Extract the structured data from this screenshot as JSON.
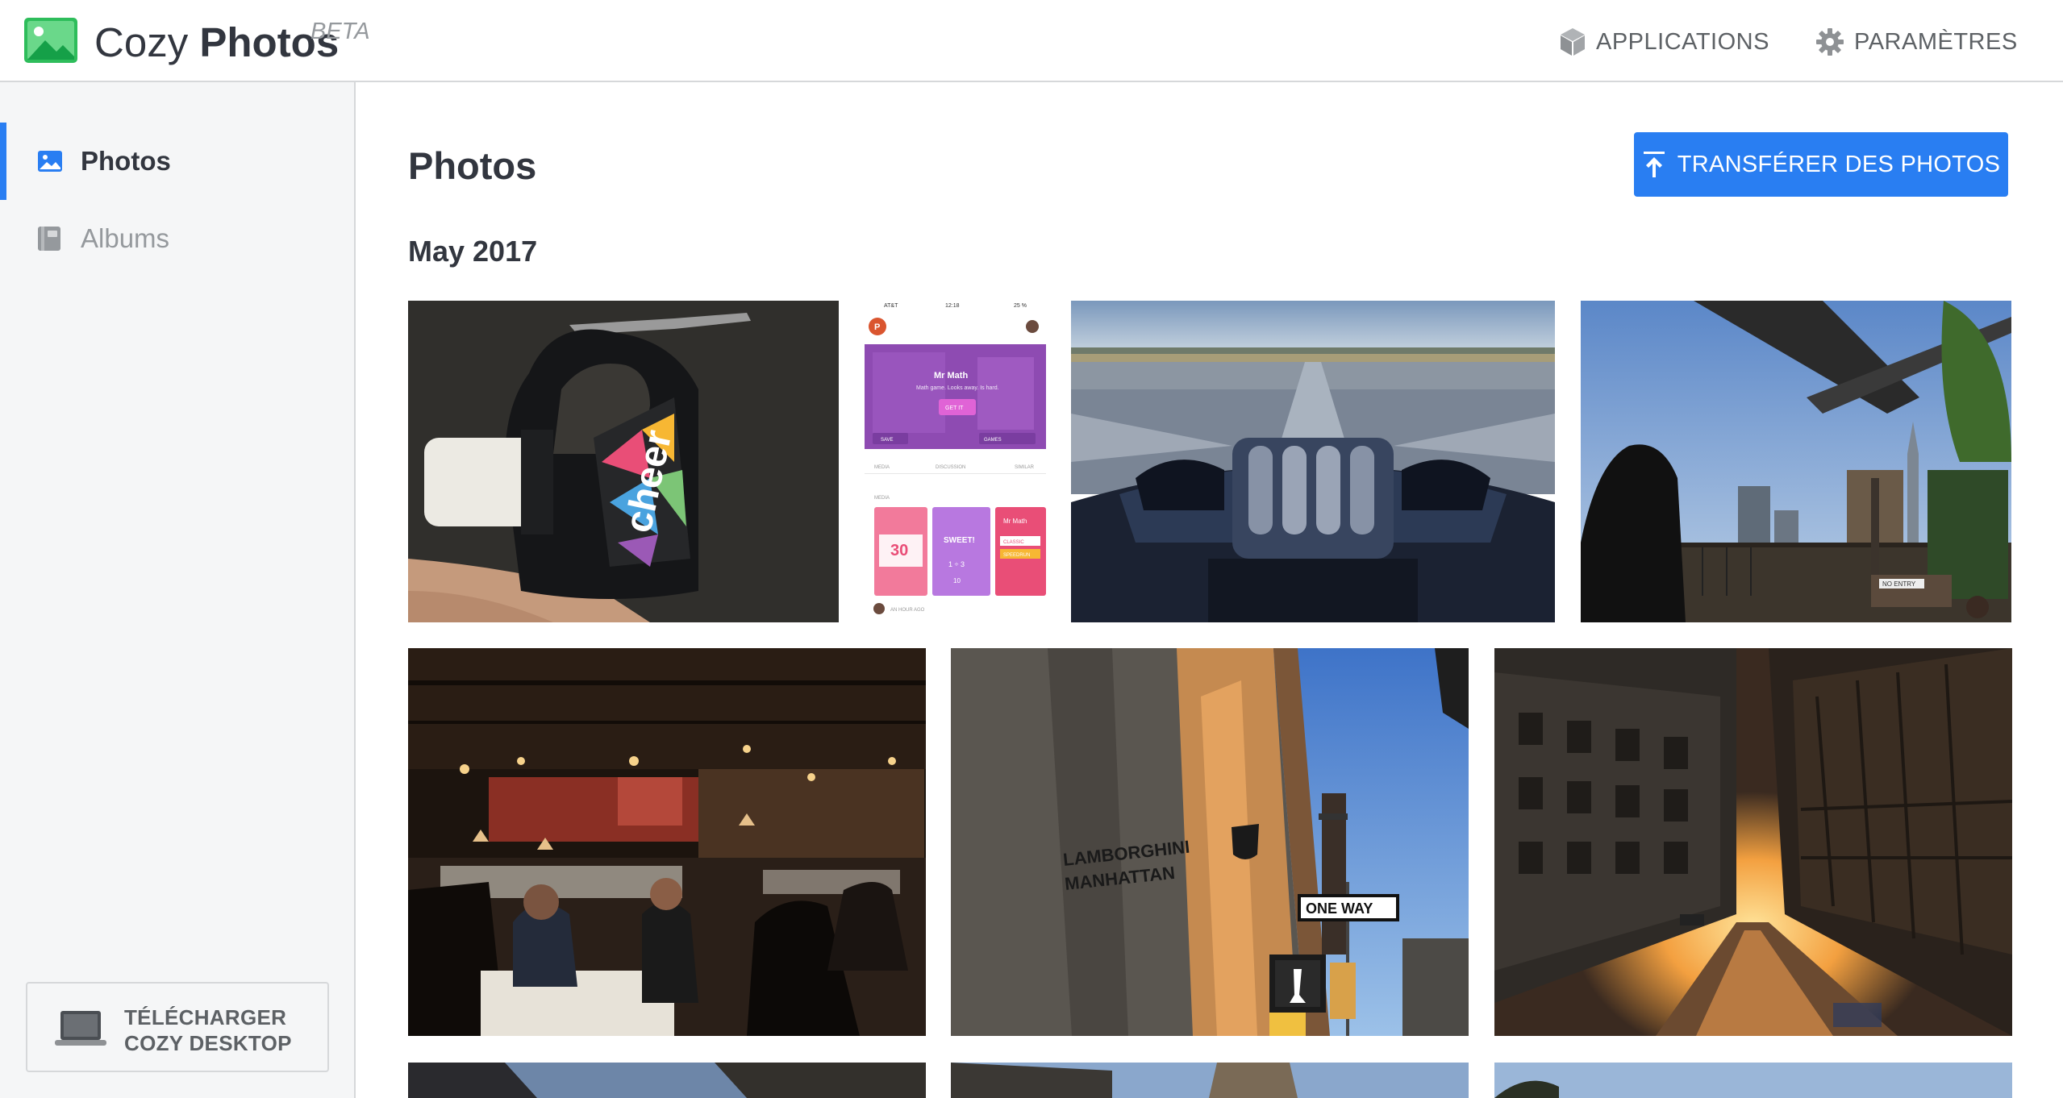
{
  "header": {
    "brand_light": "Cozy ",
    "brand_bold": "Photos",
    "beta": "BETA",
    "applications_label": "APPLICATIONS",
    "settings_label": "PARAMÈTRES"
  },
  "sidebar": {
    "items": [
      {
        "label": "Photos",
        "icon": "image-icon",
        "active": true
      },
      {
        "label": "Albums",
        "icon": "album-icon",
        "active": false
      }
    ],
    "download": {
      "line1": "TÉLÉCHARGER",
      "line2": "COZY DESKTOP",
      "icon": "laptop-icon"
    }
  },
  "main": {
    "title": "Photos",
    "upload_label": "TRANSFÉRER DES PHOTOS",
    "section_title": "May 2017"
  },
  "screenshot_thumb": {
    "carrier": "AT&T",
    "time": "12:18",
    "battery": "25 %",
    "app_name": "Mr Math",
    "app_tagline": "Math game. Looks away. Is hard.",
    "get_label": "GET IT",
    "save_label": "SAVE",
    "games_label": "GAMES",
    "tabs": [
      "MEDIA",
      "DISCUSSION",
      "SIMILAR"
    ],
    "media_label": "MEDIA",
    "card_number": "30",
    "card_sweet": "SWEET!",
    "card_math": "1 ÷ 3",
    "card_answer": "10",
    "card_right": "Mr Math",
    "card_classic": "CLASSIC",
    "card_speedrun": "SPEEDRUN",
    "footer": "AN HOUR AGO"
  },
  "photo_text": {
    "cheer": "cheer",
    "building_line1": "LAMBORGHINI",
    "building_line2": "MANHATTAN",
    "one_way": "ONE WAY",
    "no_entry": "NO ENTRY"
  },
  "colors": {
    "accent": "#297ef2",
    "text": "#32363f",
    "muted": "#95999d",
    "sidebar_bg": "#f5f6f7",
    "border": "#d6d8da"
  }
}
